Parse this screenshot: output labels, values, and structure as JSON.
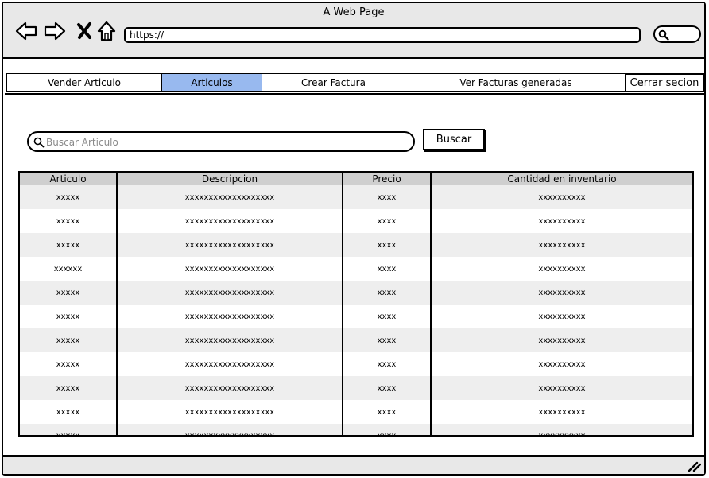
{
  "window": {
    "title": "A Web Page"
  },
  "browser": {
    "url": "https://",
    "icons": [
      "back-arrow-icon",
      "forward-arrow-icon",
      "close-x-icon",
      "home-icon",
      "search-icon"
    ]
  },
  "tabs": [
    {
      "label": "Vender Articulo",
      "active": false
    },
    {
      "label": "Articulos",
      "active": true
    },
    {
      "label": "Crear Factura",
      "active": false
    },
    {
      "label": "Ver Facturas generadas",
      "active": false
    }
  ],
  "logout_label": "Cerrar secion",
  "search": {
    "placeholder": "Buscar Articulo",
    "value": "",
    "button_label": "Buscar"
  },
  "table": {
    "headers": [
      "Articulo",
      "Descripcion",
      "Precio",
      "Cantidad en inventario"
    ],
    "rows": [
      [
        "xxxxx",
        "xxxxxxxxxxxxxxxxxxx",
        "xxxx",
        "xxxxxxxxxx"
      ],
      [
        "xxxxx",
        "xxxxxxxxxxxxxxxxxxx",
        "xxxx",
        "xxxxxxxxxx"
      ],
      [
        "xxxxx",
        "xxxxxxxxxxxxxxxxxxx",
        "xxxx",
        "xxxxxxxxxx"
      ],
      [
        "xxxxxx",
        "xxxxxxxxxxxxxxxxxxx",
        "xxxx",
        "xxxxxxxxxx"
      ],
      [
        "xxxxx",
        "xxxxxxxxxxxxxxxxxxx",
        "xxxx",
        "xxxxxxxxxx"
      ],
      [
        "xxxxx",
        "xxxxxxxxxxxxxxxxxxx",
        "xxxx",
        "xxxxxxxxxx"
      ],
      [
        "xxxxx",
        "xxxxxxxxxxxxxxxxxxx",
        "xxxx",
        "xxxxxxxxxx"
      ],
      [
        "xxxxx",
        "xxxxxxxxxxxxxxxxxxx",
        "xxxx",
        "xxxxxxxxxx"
      ],
      [
        "xxxxx",
        "xxxxxxxxxxxxxxxxxxx",
        "xxxx",
        "xxxxxxxxxx"
      ],
      [
        "xxxxx",
        "xxxxxxxxxxxxxxxxxxx",
        "xxxx",
        "xxxxxxxxxx"
      ],
      [
        "xxxxx",
        "xxxxxxxxxxxxxxxxxxx",
        "xxxx",
        "xxxxxxxxxx"
      ]
    ]
  },
  "colors": {
    "active_tab": "#98b9ef",
    "header_bg": "#cfcfcf",
    "stripe": "#eeeeee",
    "chrome": "#e8e8e8"
  }
}
